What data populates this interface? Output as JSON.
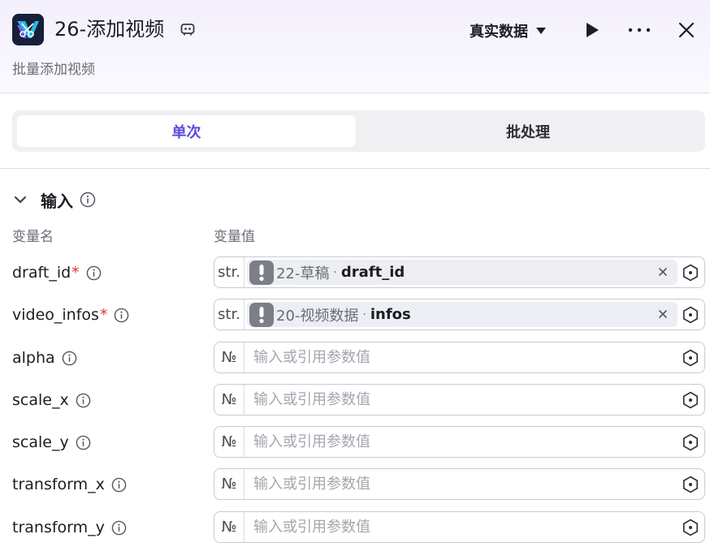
{
  "header": {
    "title": "26-添加视频",
    "subtitle": "批量添加视频",
    "data_mode": "真实数据"
  },
  "tabs": [
    {
      "label": "单次",
      "active": true
    },
    {
      "label": "批处理",
      "active": false
    }
  ],
  "section": {
    "title": "输入",
    "col_name": "变量名",
    "col_value": "变量值"
  },
  "rows": [
    {
      "name": "draft_id",
      "required": "*",
      "type": "str.",
      "ref_node": "22-草稿",
      "ref_var": "draft_id"
    },
    {
      "name": "video_infos",
      "required": "*",
      "type": "str.",
      "ref_node": "20-视频数据",
      "ref_var": "infos"
    },
    {
      "name": "alpha",
      "type": "№",
      "placeholder": "输入或引用参数值"
    },
    {
      "name": "scale_x",
      "type": "№",
      "placeholder": "输入或引用参数值"
    },
    {
      "name": "scale_y",
      "type": "№",
      "placeholder": "输入或引用参数值"
    },
    {
      "name": "transform_x",
      "type": "№",
      "placeholder": "输入或引用参数值"
    },
    {
      "name": "transform_y",
      "type": "№",
      "placeholder": "输入或引用参数值"
    }
  ],
  "colors": {
    "accent": "#5a4bdb",
    "required": "#e0323a",
    "badge": "#7c7e88"
  },
  "icons": {
    "app": "app-icon",
    "edit": "edit-icon",
    "run": "play-icon",
    "more": "more-icon",
    "close": "close-icon",
    "chevron": "chevron-down-icon",
    "info": "info-icon",
    "warning": "warning-icon",
    "clear": "clear-icon",
    "reference": "reference-icon"
  }
}
